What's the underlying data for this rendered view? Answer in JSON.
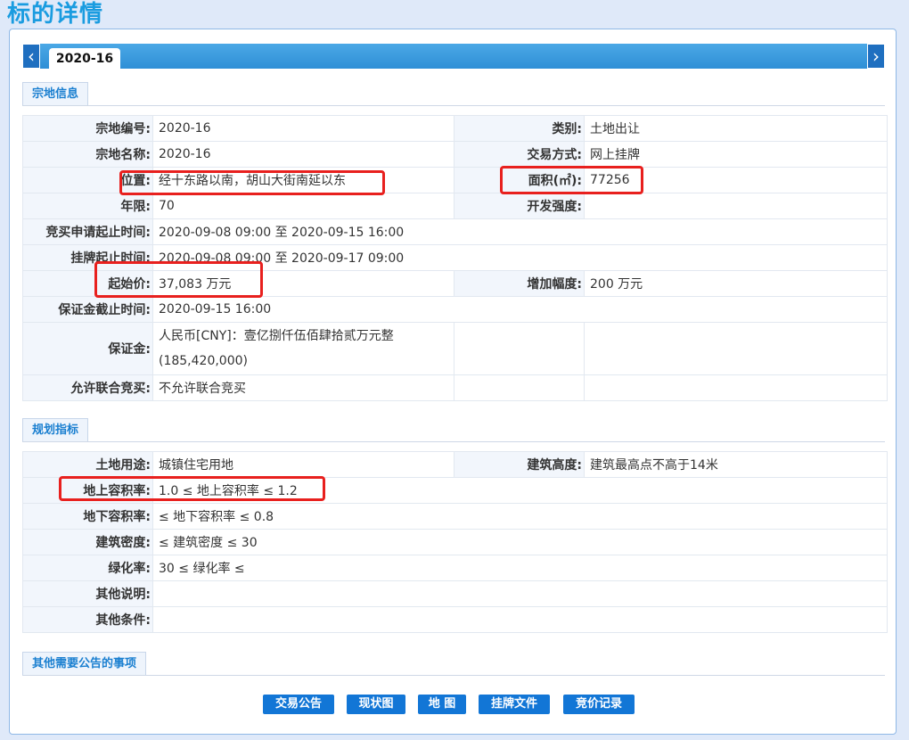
{
  "page": {
    "title": "标的详情"
  },
  "tab": {
    "active": "2020-16",
    "prev_icon": "chevron-left-icon",
    "next_icon": "chevron-right-icon"
  },
  "section1": {
    "label": "宗地信息",
    "rows": [
      {
        "l1": "宗地编号:",
        "v1": "2020-16",
        "l2": "类别:",
        "v2": "土地出让"
      },
      {
        "l1": "宗地名称:",
        "v1": "2020-16",
        "l2": "交易方式:",
        "v2": "网上挂牌"
      },
      {
        "l1": "位置:",
        "v1": "经十东路以南，胡山大街南延以东",
        "l2": "面积(㎡):",
        "v2": "77256"
      },
      {
        "l1": "年限:",
        "v1": "70",
        "l2": "开发强度:",
        "v2": ""
      },
      {
        "l1": "竞买申请起止时间:",
        "v1": "2020-09-08 09:00 至 2020-09-15 16:00"
      },
      {
        "l1": "挂牌起止时间:",
        "v1": "2020-09-08 09:00 至 2020-09-17 09:00"
      },
      {
        "l1": "起始价:",
        "v1": "37,083 万元",
        "l2": "增加幅度:",
        "v2": "200 万元"
      },
      {
        "l1": "保证金截止时间:",
        "v1": "2020-09-15 16:00"
      },
      {
        "l1": "保证金:",
        "v1a": "人民币[CNY]：壹亿捌仟伍佰肆拾贰万元整",
        "v1b": "(185,420,000)"
      },
      {
        "l1": "允许联合竞买:",
        "v1": "不允许联合竞买"
      }
    ]
  },
  "section2": {
    "label": "规划指标",
    "rows": [
      {
        "l1": "土地用途:",
        "v1": "城镇住宅用地",
        "l2": "建筑高度:",
        "v2": "建筑最高点不高于14米"
      },
      {
        "l1": "地上容积率:",
        "v1": "1.0 ≤ 地上容积率 ≤ 1.2"
      },
      {
        "l1": "地下容积率:",
        "v1": "≤ 地下容积率 ≤ 0.8"
      },
      {
        "l1": "建筑密度:",
        "v1": "≤ 建筑密度 ≤ 30"
      },
      {
        "l1": "绿化率:",
        "v1": "30 ≤ 绿化率 ≤"
      },
      {
        "l1": "其他说明:",
        "v1": ""
      },
      {
        "l1": "其他条件:",
        "v1": ""
      }
    ]
  },
  "section3": {
    "label": "其他需要公告的事项"
  },
  "buttons": {
    "b1": "交易公告",
    "b2": "现状图",
    "b3": "地 图",
    "b4": "挂牌文件",
    "b5": "竞价记录"
  },
  "colors": {
    "accent": "#1a9ce0",
    "button": "#1276d6",
    "highlight": "#e8201e"
  }
}
